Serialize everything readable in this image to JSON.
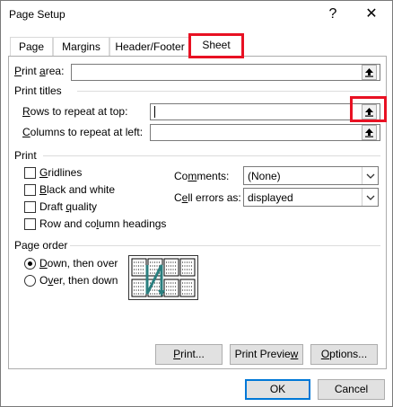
{
  "window": {
    "title": "Page Setup",
    "help_glyph": "?",
    "close_glyph": "✕"
  },
  "tabs": [
    {
      "label": "Page"
    },
    {
      "label": "Margins"
    },
    {
      "label": "Header/Footer"
    },
    {
      "label": "Sheet",
      "active": true
    }
  ],
  "print_area": {
    "label": "Print area:",
    "value": ""
  },
  "print_titles": {
    "heading": "Print titles",
    "rows": {
      "label": "Rows to repeat at top:",
      "value": ""
    },
    "columns": {
      "label": "Columns to repeat at left:",
      "value": ""
    }
  },
  "print": {
    "heading": "Print",
    "checkboxes": [
      {
        "label": "Gridlines",
        "checked": false
      },
      {
        "label": "Black and white",
        "checked": false
      },
      {
        "label": "Draft quality",
        "checked": false
      },
      {
        "label": "Row and column headings",
        "checked": false
      }
    ],
    "comments": {
      "label": "Comments:",
      "value": "(None)"
    },
    "cell_errors": {
      "label": "Cell errors as:",
      "value": "displayed"
    }
  },
  "page_order": {
    "heading": "Page order",
    "options": [
      {
        "label": "Down, then over",
        "selected": true
      },
      {
        "label": "Over, then down",
        "selected": false
      }
    ]
  },
  "buttons": {
    "print": "Print...",
    "print_preview": "Print Preview",
    "options": "Options...",
    "ok": "OK",
    "cancel": "Cancel"
  },
  "colors": {
    "highlight": "#e81123",
    "focus_border": "#0078d7",
    "arrow_teal": "#2a7f7f"
  }
}
